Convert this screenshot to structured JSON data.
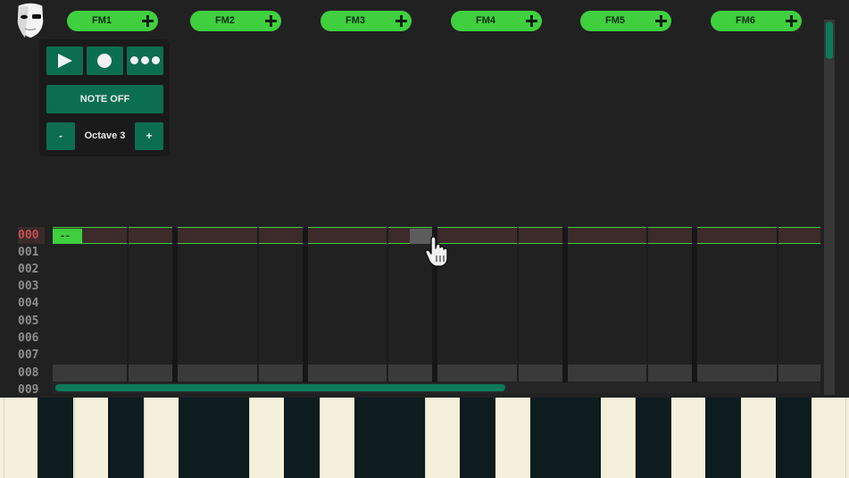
{
  "app": {
    "logo_icon": "mask-icon"
  },
  "channels": [
    {
      "label": "FM1"
    },
    {
      "label": "FM2"
    },
    {
      "label": "FM3"
    },
    {
      "label": "FM4"
    },
    {
      "label": "FM5"
    },
    {
      "label": "FM6"
    }
  ],
  "controls": {
    "play_icon": "play-icon",
    "record_icon": "record-icon",
    "more_icon": "more-icon",
    "note_off_label": "NOTE OFF",
    "octave_minus_label": "-",
    "octave_plus_label": "+",
    "octave_label": "Octave 3"
  },
  "tracker": {
    "rows": [
      "000",
      "001",
      "002",
      "003",
      "004",
      "005",
      "006",
      "007",
      "008",
      "009"
    ],
    "current_row": "000",
    "cursor_value": "--",
    "hover_value": "-"
  },
  "colors": {
    "accent_green": "#3fcf3f",
    "button_teal": "#0b6e4f",
    "background": "#212121",
    "piano_white": "#f5f0dc",
    "piano_black": "#0d1c1e"
  }
}
